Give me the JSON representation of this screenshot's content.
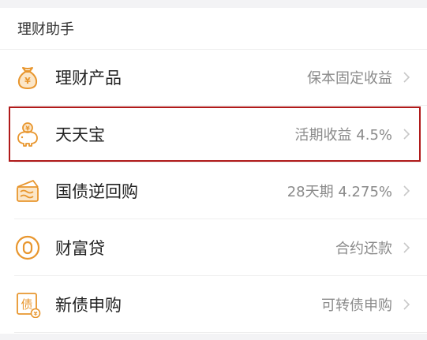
{
  "section": {
    "title": "理财助手"
  },
  "items": [
    {
      "title": "理财产品",
      "subtitle": "保本固定收益",
      "icon": "money-bag-icon",
      "highlighted": false
    },
    {
      "title": "天天宝",
      "subtitle": "活期收益 4.5%",
      "icon": "piggy-bank-icon",
      "highlighted": true
    },
    {
      "title": "国债逆回购",
      "subtitle": "28天期 4.275%",
      "icon": "bond-wave-icon",
      "highlighted": false
    },
    {
      "title": "财富贷",
      "subtitle": "合约还款",
      "icon": "loan-circle-icon",
      "highlighted": false
    },
    {
      "title": "新债申购",
      "subtitle": "可转债申购",
      "icon": "bond-badge-icon",
      "highlighted": false
    }
  ],
  "colors": {
    "accent": "#e8962e",
    "highlight_border": "#b01a1a"
  }
}
